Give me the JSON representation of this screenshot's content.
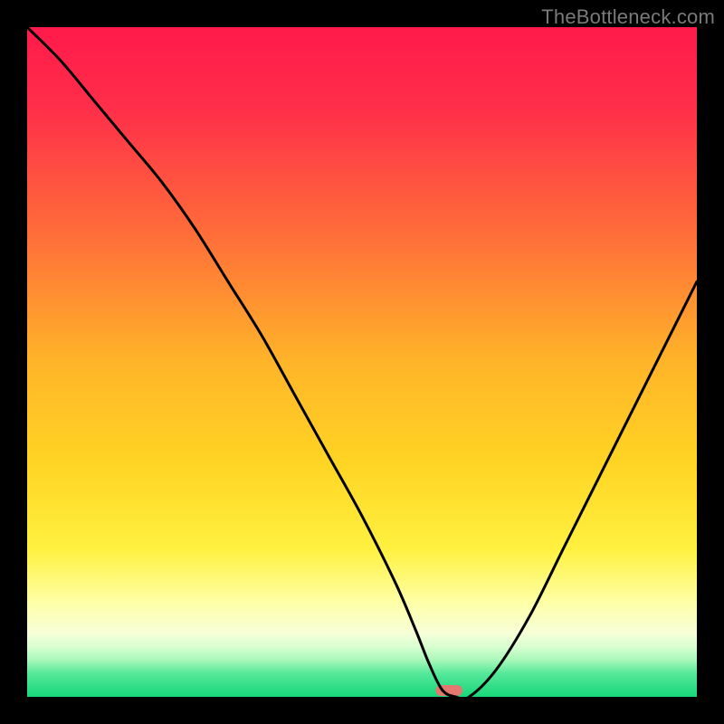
{
  "watermark": "TheBottleneck.com",
  "chart_data": {
    "type": "line",
    "title": "",
    "xlabel": "",
    "ylabel": "",
    "xlim": [
      0,
      100
    ],
    "ylim": [
      0,
      100
    ],
    "background_gradient_stops": [
      {
        "offset": 0.0,
        "color": "#ff1a4b"
      },
      {
        "offset": 0.12,
        "color": "#ff2e4a"
      },
      {
        "offset": 0.3,
        "color": "#ff6a3a"
      },
      {
        "offset": 0.5,
        "color": "#ffb429"
      },
      {
        "offset": 0.65,
        "color": "#ffd423"
      },
      {
        "offset": 0.78,
        "color": "#fff140"
      },
      {
        "offset": 0.86,
        "color": "#feffa8"
      },
      {
        "offset": 0.905,
        "color": "#f7ffd8"
      },
      {
        "offset": 0.925,
        "color": "#d8ffd0"
      },
      {
        "offset": 0.945,
        "color": "#a8f7b8"
      },
      {
        "offset": 0.965,
        "color": "#56e89a"
      },
      {
        "offset": 1.0,
        "color": "#18d67a"
      }
    ],
    "series": [
      {
        "name": "bottleneck-curve",
        "x": [
          0,
          5,
          10,
          15,
          20,
          25,
          30,
          35,
          40,
          45,
          50,
          55,
          58,
          60,
          62,
          64,
          66,
          70,
          75,
          80,
          85,
          90,
          95,
          100
        ],
        "y": [
          100,
          95,
          89,
          83,
          77,
          70,
          62,
          54,
          45,
          36,
          27,
          17,
          10,
          5,
          1,
          0,
          0,
          4,
          12,
          22,
          32,
          42,
          52,
          62
        ]
      }
    ],
    "marker": {
      "name": "optimum-marker",
      "x_center": 63,
      "width_pct": 4,
      "color": "#e2786f"
    }
  }
}
